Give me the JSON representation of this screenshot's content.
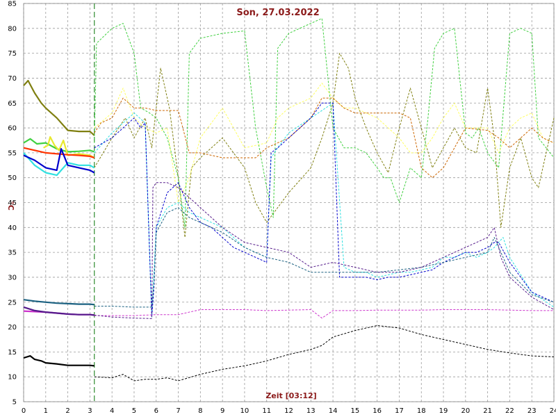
{
  "chart_data": {
    "type": "line",
    "title": "Son, 27.03.2022",
    "xlabel": "Zeit [03:12]",
    "ylabel": "°C",
    "xlim": [
      0,
      24
    ],
    "ylim": [
      5,
      85
    ],
    "x_ticks": [
      0,
      1,
      2,
      3,
      4,
      5,
      6,
      7,
      8,
      9,
      10,
      11,
      12,
      13,
      14,
      15,
      16,
      17,
      18,
      19,
      20,
      21,
      22,
      23,
      24
    ],
    "y_ticks": [
      5,
      10,
      15,
      20,
      25,
      30,
      35,
      40,
      45,
      50,
      55,
      60,
      65,
      70,
      75,
      80,
      85
    ],
    "grid": true,
    "current_time_marker": 3.2,
    "colors": {
      "title": "#8b1a1a",
      "grid": "#9a9a9a",
      "marker": "#2e8b2e"
    },
    "series": [
      {
        "color": "#7f7f10",
        "style": "solid",
        "x": [
          0,
          0.2,
          0.5,
          0.8,
          1.0,
          1.5,
          2.0,
          2.5,
          3.0,
          3.2
        ],
        "y": [
          68.5,
          69.5,
          67,
          65,
          64,
          62,
          59.5,
          59.3,
          59.3,
          58.5
        ]
      },
      {
        "color": "#7f7f10",
        "style": "dashed",
        "x": [
          3.2,
          4,
          4.6,
          5.0,
          5.5,
          5.8,
          6.2,
          6.6,
          7.0,
          7.3,
          7.6,
          8,
          9,
          10,
          10.5,
          11,
          12,
          13,
          13.5,
          14,
          14.3,
          14.7,
          15,
          15.5,
          16,
          16.5,
          17,
          17.5,
          18,
          18.5,
          19,
          19.5,
          20,
          20.5,
          21,
          21.3,
          21.6,
          22,
          22.5,
          23,
          23.3,
          24
        ],
        "y": [
          52,
          58,
          62,
          58,
          62,
          56,
          72,
          64,
          50,
          38,
          52,
          54,
          58,
          52,
          45,
          41,
          47,
          52,
          58,
          65,
          75,
          72,
          66,
          60,
          55,
          51,
          60,
          68,
          60,
          52,
          56,
          60,
          56,
          55,
          68,
          58,
          40,
          52,
          58,
          50,
          48,
          62
        ]
      },
      {
        "color": "#40d040",
        "style": "solid",
        "x": [
          0,
          0.3,
          0.6,
          1.0,
          1.5,
          2.0,
          2.5,
          3.0,
          3.2
        ],
        "y": [
          57,
          57.8,
          56.8,
          57,
          55.8,
          55.2,
          55.3,
          55.5,
          55.2
        ]
      },
      {
        "color": "#40d040",
        "style": "dashed",
        "x": [
          3.2,
          3.3,
          4,
          4.5,
          5,
          5.3,
          5.7,
          6,
          6.5,
          7,
          7.3,
          7.5,
          8,
          9,
          10,
          10.5,
          11,
          11.3,
          11.5,
          12,
          13,
          13.5,
          14,
          14.5,
          15,
          15.5,
          16,
          16.3,
          16.6,
          17,
          17.5,
          18,
          18.3,
          18.6,
          19,
          19.5,
          20,
          20.3,
          20.6,
          21,
          21.5,
          22,
          22.5,
          23,
          23.3,
          24
        ],
        "y": [
          57,
          77,
          80,
          81,
          75,
          64,
          63,
          62,
          58,
          50,
          40,
          75,
          78,
          79,
          79.5,
          60,
          48,
          42,
          76,
          79,
          81,
          82,
          60,
          56,
          56,
          55,
          52,
          50,
          50,
          45,
          52,
          50,
          62,
          76,
          79,
          80,
          59,
          58,
          60,
          55,
          52,
          79,
          80,
          79,
          58,
          54
        ]
      },
      {
        "color": "#e8e830",
        "style": "solid",
        "x": [
          0.9,
          1.1,
          1.2,
          1.4,
          1.6,
          1.8,
          2.0,
          2.5,
          3.0,
          3.2
        ],
        "y": [
          56,
          56.5,
          58.2,
          56.5,
          55.5,
          57.5,
          54.5,
          54.8,
          54.5,
          54
        ]
      },
      {
        "color": "#ffff60",
        "style": "dashed",
        "x": [
          3.2,
          4,
          4.5,
          5,
          5.5,
          6,
          6.5,
          7,
          7.5,
          8,
          9,
          10,
          11,
          11.5,
          12,
          13,
          13.5,
          14,
          14.5,
          15,
          16,
          17,
          17.5,
          18,
          18.5,
          19,
          19.5,
          20,
          21,
          21.5,
          22,
          22.5,
          23,
          23.5,
          24
        ],
        "y": [
          60,
          63,
          68,
          62,
          60,
          59,
          60,
          45,
          50,
          58,
          64,
          56,
          57,
          62,
          64,
          66,
          69,
          66,
          64,
          64,
          62,
          58,
          55,
          55,
          58,
          62,
          65,
          60,
          60,
          55,
          60,
          62,
          63,
          58,
          57
        ]
      },
      {
        "color": "#ff3300",
        "style": "solid",
        "x": [
          0,
          0.5,
          1.0,
          1.5,
          2.0,
          2.5,
          3.0,
          3.2
        ],
        "y": [
          56,
          55.5,
          55,
          54.8,
          54.6,
          54.5,
          54.3,
          54
        ]
      },
      {
        "color": "#cc6600",
        "style": "dashed",
        "x": [
          3.2,
          3.5,
          4,
          4.5,
          5,
          5.5,
          6,
          7,
          7.5,
          8,
          9,
          10,
          10.5,
          11,
          12,
          13,
          13.5,
          14,
          14.5,
          15,
          16,
          17,
          17.5,
          18,
          18.5,
          19,
          20,
          21,
          21.5,
          22,
          22.5,
          23,
          23.5,
          24
        ],
        "y": [
          59,
          61,
          62,
          66,
          64,
          64,
          63.5,
          63.5,
          55,
          55,
          54,
          54,
          54,
          56,
          58,
          62,
          66,
          66,
          64,
          63,
          63,
          63,
          62,
          52,
          50,
          52,
          60,
          59.5,
          58,
          56,
          58,
          60,
          58,
          57
        ]
      },
      {
        "color": "#30e0e0",
        "style": "solid",
        "x": [
          0,
          0.5,
          1.0,
          1.5,
          2.0,
          2.5,
          3.0,
          3.2
        ],
        "y": [
          55,
          52.5,
          51,
          50.5,
          53,
          52.5,
          52.5,
          52
        ]
      },
      {
        "color": "#30e0e0",
        "style": "dashed",
        "x": [
          3.2,
          4,
          5,
          5.5,
          5.8,
          6.0,
          6.5,
          7,
          7.5,
          8,
          8.5,
          9,
          9.5,
          10,
          11,
          11.2,
          11.5,
          12,
          13,
          14,
          14.5,
          15,
          15.5,
          16,
          16.5,
          17,
          17.5,
          18,
          18.5,
          19,
          19.5,
          20,
          20.5,
          21,
          21.3,
          21.7,
          22,
          23,
          24
        ],
        "y": [
          55,
          59,
          63,
          61,
          22,
          40,
          44,
          45,
          43,
          42,
          41,
          40,
          38,
          36,
          34,
          54,
          56,
          59,
          62,
          65,
          32,
          31,
          31,
          30,
          30.5,
          31,
          31,
          31.5,
          32,
          34,
          34,
          35,
          34,
          35,
          36,
          38,
          34,
          27,
          24
        ]
      },
      {
        "color": "#0000cc",
        "style": "solid",
        "x": [
          0,
          0.5,
          1.0,
          1.5,
          1.7,
          2.0,
          2.5,
          3.0,
          3.2
        ],
        "y": [
          54.5,
          53.5,
          52,
          51.5,
          55.8,
          52.5,
          52,
          51.5,
          51
        ]
      },
      {
        "color": "#0000cc",
        "style": "dashed",
        "x": [
          3.2,
          4,
          5,
          5.3,
          5.5,
          5.8,
          5.9,
          6.0,
          6.5,
          7,
          7.5,
          8,
          8.5,
          9,
          9.5,
          10,
          11,
          11.2,
          11.5,
          12,
          13,
          13.5,
          14,
          14.3,
          15,
          15.5,
          16,
          16.5,
          17,
          17.5,
          18,
          18.5,
          19,
          19.5,
          20,
          20.5,
          21,
          21.3,
          21.5,
          22,
          23,
          24
        ],
        "y": [
          56,
          58,
          62,
          60,
          61,
          22,
          28,
          40,
          47,
          49,
          44,
          41,
          40,
          38,
          36,
          35,
          33,
          55,
          56,
          58,
          62,
          65,
          65,
          30,
          30,
          30,
          29.5,
          30,
          30,
          30.5,
          31,
          31.5,
          33,
          34,
          35,
          35,
          36,
          37,
          37,
          33,
          27,
          25
        ]
      },
      {
        "color": "#1a6080",
        "style": "solid",
        "x": [
          0,
          0.5,
          1.0,
          1.5,
          2.0,
          2.5,
          3.0,
          3.2
        ],
        "y": [
          25.5,
          25.2,
          25,
          24.8,
          24.7,
          24.6,
          24.6,
          24.5
        ]
      },
      {
        "color": "#1a6080",
        "style": "dashed",
        "x": [
          3.2,
          4,
          5,
          5.8,
          5.9,
          6.0,
          6.5,
          7,
          7.5,
          8,
          9,
          10,
          11,
          12,
          13,
          14,
          15,
          16,
          17,
          18,
          19,
          20,
          21,
          21.3,
          21.6,
          22,
          23,
          24
        ],
        "y": [
          24.2,
          24.2,
          24,
          24,
          29,
          39,
          43,
          44,
          42,
          41,
          39,
          36,
          34,
          33,
          31,
          31,
          31,
          31,
          31.5,
          32,
          33,
          34,
          35,
          38,
          35,
          31,
          26.5,
          25
        ]
      },
      {
        "color": "#cc33cc",
        "style": "solid",
        "x": [
          0,
          0.5,
          1.0,
          1.5,
          2.0,
          2.5,
          3.0,
          3.2
        ],
        "y": [
          23.2,
          23.1,
          23.0,
          22.8,
          22.6,
          22.5,
          22.5,
          22.4
        ]
      },
      {
        "color": "#cc33cc",
        "style": "dashed",
        "x": [
          3.2,
          4,
          5,
          6,
          7,
          8,
          9,
          10,
          11,
          12,
          13,
          13.5,
          14,
          15,
          16,
          17,
          18,
          19,
          20,
          21,
          22,
          23,
          24
        ],
        "y": [
          22.3,
          22.3,
          22.3,
          22.5,
          22.5,
          23.5,
          23.5,
          23.5,
          23.3,
          23.4,
          23.5,
          21.8,
          23.3,
          23.3,
          23.4,
          23.4,
          23.4,
          23.5,
          23.5,
          23.5,
          23.4,
          23.3,
          23.3
        ]
      },
      {
        "color": "#551a8b",
        "style": "solid",
        "x": [
          0,
          0.5,
          1.0,
          1.5,
          2.0,
          2.5,
          3.0,
          3.2
        ],
        "y": [
          24,
          23.3,
          23,
          22.8,
          22.6,
          22.5,
          22.5,
          22.4
        ]
      },
      {
        "color": "#551a8b",
        "style": "dashed",
        "x": [
          3.2,
          4,
          5,
          5.8,
          5.85,
          6.0,
          6.5,
          7,
          7.5,
          8,
          9,
          10,
          11,
          12,
          13,
          14,
          15,
          16,
          17,
          18,
          19,
          20,
          21,
          21.3,
          21.6,
          22,
          23,
          24
        ],
        "y": [
          22.4,
          22,
          21.8,
          21.7,
          48,
          49,
          49,
          48,
          46,
          44,
          40,
          37,
          36,
          35,
          32,
          33,
          32,
          31,
          31,
          32,
          34,
          36,
          38,
          40,
          34,
          30,
          26,
          23.5
        ]
      },
      {
        "color": "#000000",
        "style": "solid",
        "x": [
          0,
          0.3,
          0.5,
          0.8,
          1.0,
          1.5,
          2.0,
          2.5,
          3.0,
          3.2
        ],
        "y": [
          13.8,
          14.2,
          13.5,
          13.2,
          12.8,
          12.6,
          12.3,
          12.3,
          12.3,
          12.2
        ]
      },
      {
        "color": "#000000",
        "style": "dashed",
        "x": [
          3.2,
          4,
          4.5,
          5,
          5.5,
          6,
          6.5,
          7,
          7.3,
          8,
          9,
          10,
          11,
          12,
          13,
          13.5,
          14,
          15,
          16,
          17,
          18,
          19,
          20,
          21,
          22,
          23,
          24
        ],
        "y": [
          10,
          9.8,
          10.5,
          9.2,
          9.5,
          9.5,
          9.8,
          9.2,
          9.6,
          10.5,
          11.5,
          12.2,
          13.2,
          14.5,
          15.5,
          16.3,
          18,
          19.3,
          20.3,
          19.8,
          18.5,
          17.5,
          16.5,
          15.5,
          14.8,
          14.2,
          14
        ]
      }
    ]
  }
}
